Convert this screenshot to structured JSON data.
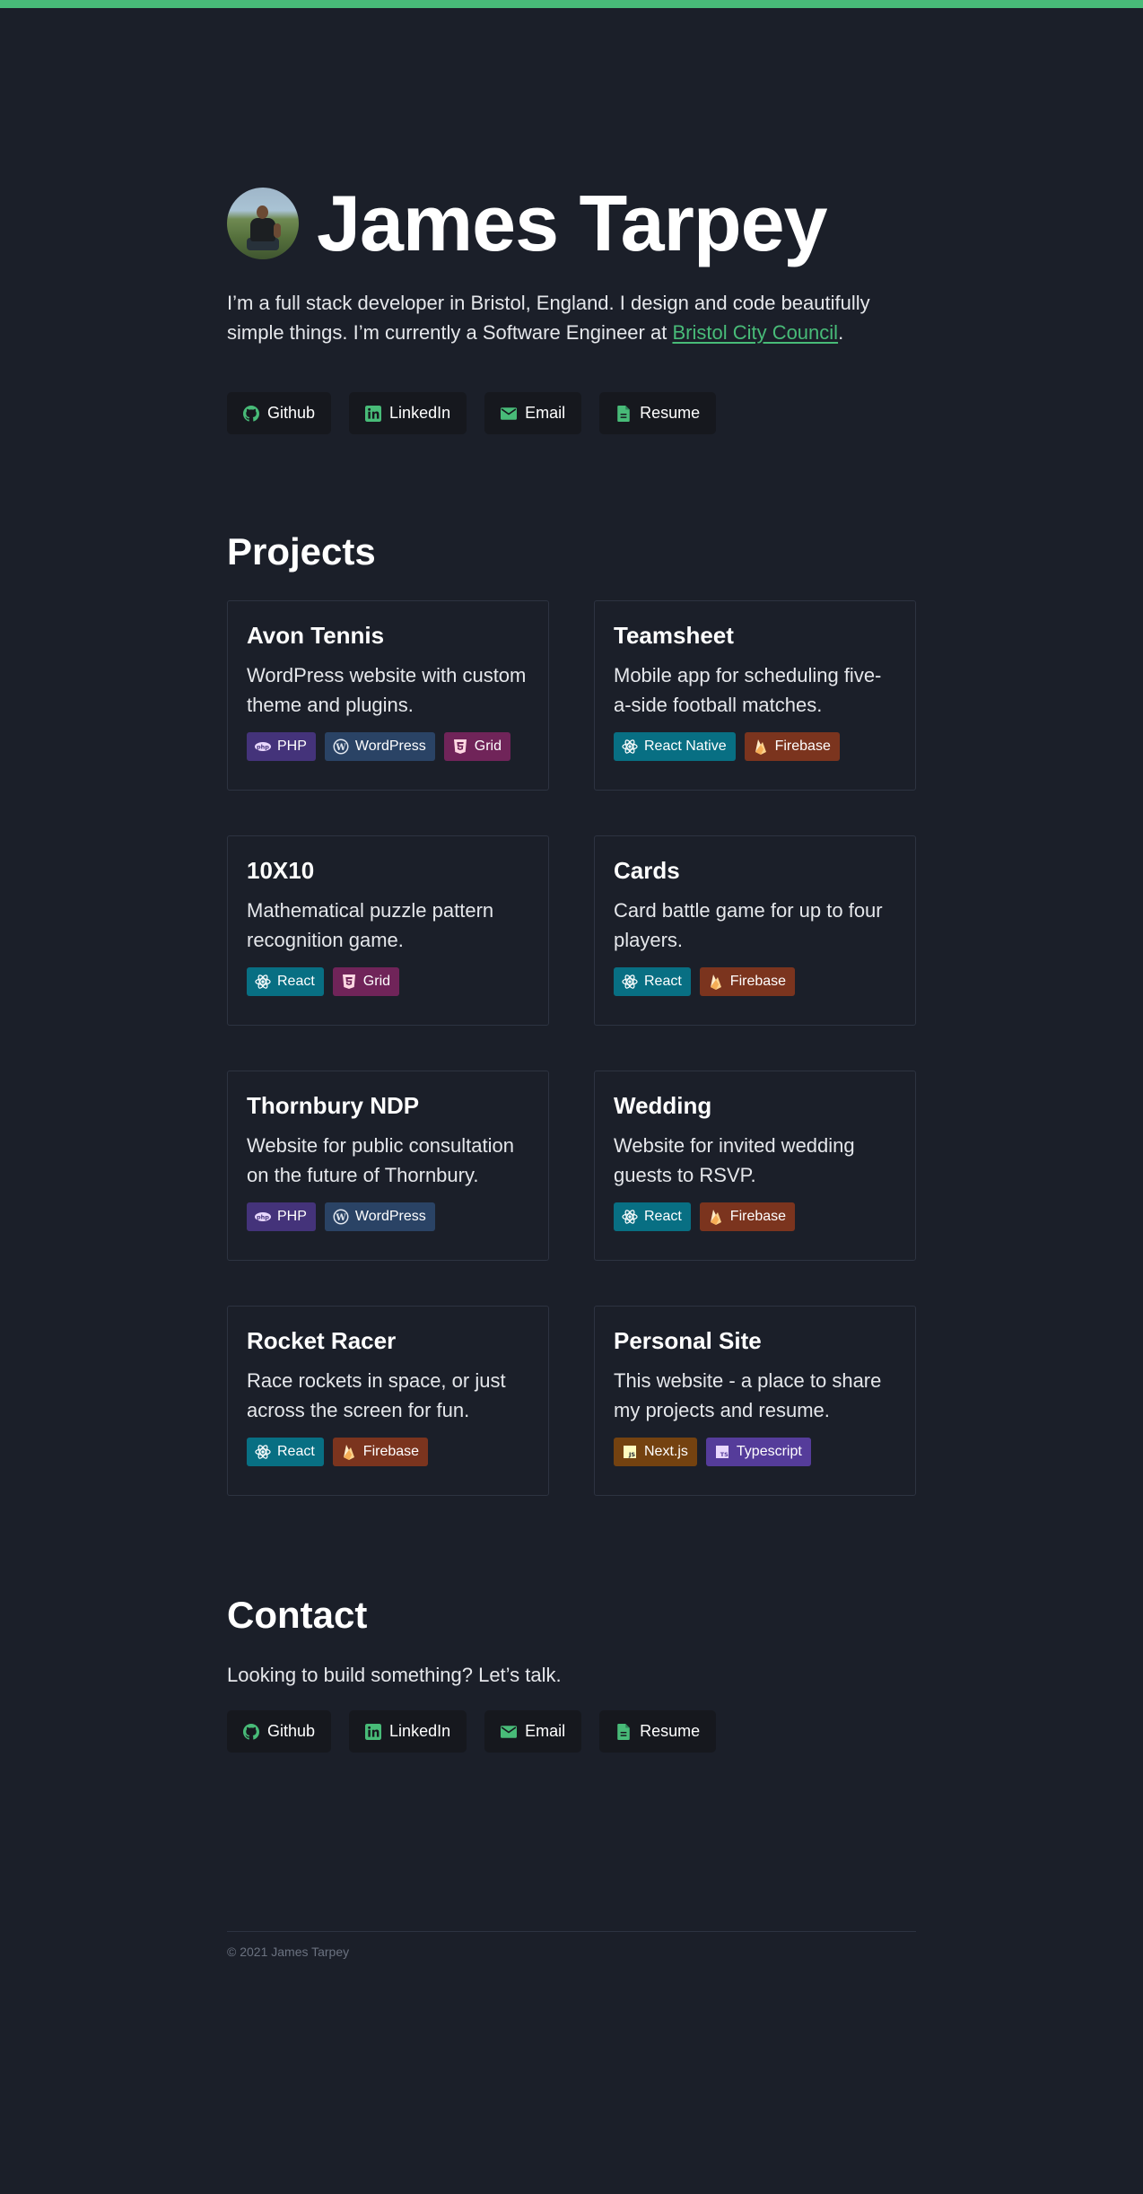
{
  "colors": {
    "accent": "#48bb78",
    "background": "#1b1f29",
    "button_bg": "#16181e",
    "tag_php": "#44337a",
    "tag_wordpress": "#2a4365",
    "tag_grid": "#702459",
    "tag_react": "#086f83",
    "tag_firebase": "#7b341e",
    "tag_nextjs": "#744210",
    "tag_typescript": "#553c9a"
  },
  "header": {
    "name": "James Tarpey",
    "intro_text": "I’m a full stack developer in Bristol, England. I design and code beautifully simple things. I’m currently a Software Engineer at ",
    "intro_link": "Bristol City Council",
    "intro_end": "."
  },
  "links": {
    "github": "Github",
    "linkedin": "LinkedIn",
    "email": "Email",
    "resume": "Resume"
  },
  "projects": {
    "title": "Projects",
    "items": [
      {
        "title": "Avon Tennis",
        "description": "WordPress website with custom theme and plugins.",
        "tags": [
          "PHP",
          "WordPress",
          "Grid"
        ]
      },
      {
        "title": "Teamsheet",
        "description": "Mobile app for scheduling five-a-side football matches.",
        "tags": [
          "React Native",
          "Firebase"
        ]
      },
      {
        "title": "10X10",
        "description": "Mathematical puzzle pattern recognition game.",
        "tags": [
          "React",
          "Grid"
        ]
      },
      {
        "title": "Cards",
        "description": "Card battle game for up to four players.",
        "tags": [
          "React",
          "Firebase"
        ]
      },
      {
        "title": "Thornbury NDP",
        "description": "Website for public consultation on the future of Thornbury.",
        "tags": [
          "PHP",
          "WordPress"
        ]
      },
      {
        "title": "Wedding",
        "description": "Website for invited wedding guests to RSVP.",
        "tags": [
          "React",
          "Firebase"
        ]
      },
      {
        "title": "Rocket Racer",
        "description": "Race rockets in space, or just across the screen for fun.",
        "tags": [
          "React",
          "Firebase"
        ]
      },
      {
        "title": "Personal Site",
        "description": "This website - a place to share my projects and resume.",
        "tags": [
          "Next.js",
          "Typescript"
        ]
      }
    ]
  },
  "contact": {
    "title": "Contact",
    "text": "Looking to build something? Let’s talk."
  },
  "footer": {
    "copyright": "© 2021 James Tarpey"
  }
}
